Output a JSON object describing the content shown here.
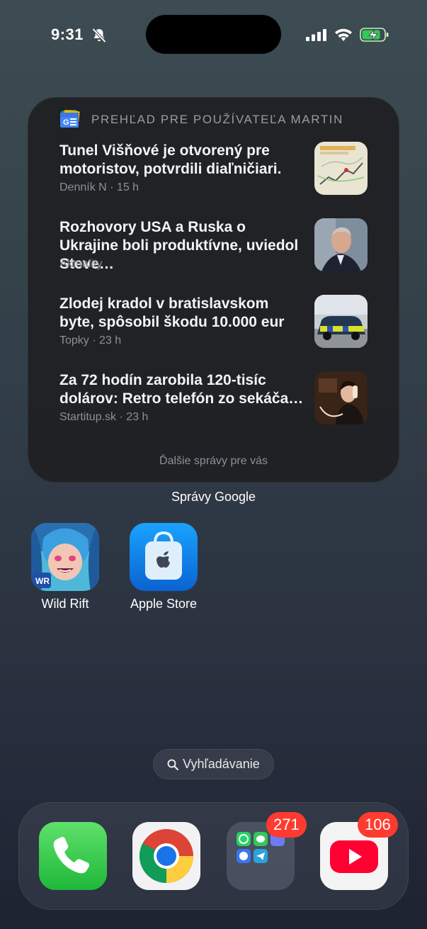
{
  "status_bar": {
    "time": "9:31"
  },
  "widget": {
    "header": "PREHĽAD PRE POUŽÍVATEĽA MARTIN",
    "items": [
      {
        "title": "Tunel Višňové je otvorený pre motoristov, potvrdili diaľničiari.",
        "meta": "Denník N · 15 h"
      },
      {
        "title": "Rozhovory USA a Ruska o Ukrajine boli produktívne, uviedol Steve…",
        "meta": "Aktuality"
      },
      {
        "title": "Zlodej kradol v bratislavskom byte, spôsobil škodu 10.000 eur",
        "meta": "Topky · 23 h"
      },
      {
        "title": "Za 72 hodín zarobila 120-tisíc dolárov: Retro telefón zo sekáča…",
        "meta": "Startitup.sk · 23 h"
      }
    ],
    "more": "Ďalšie správy pre vás",
    "caption": "Správy Google"
  },
  "apps": [
    {
      "label": "Wild Rift"
    },
    {
      "label": "Apple Store"
    }
  ],
  "search": {
    "label": "Vyhľadávanie"
  },
  "dock": {
    "folder_badge": "271",
    "youtube_badge": "106"
  },
  "colors": {
    "badge": "#ff3b30",
    "phone": "#34c759",
    "youtube": "#ff0033"
  }
}
